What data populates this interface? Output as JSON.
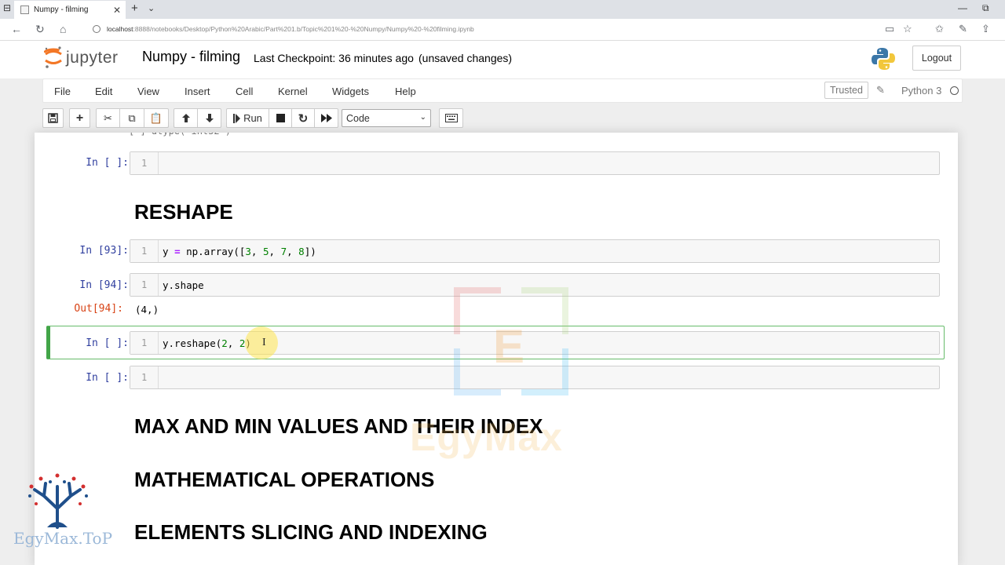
{
  "browser": {
    "tab_title": "Numpy - filming",
    "tab_close": "✕",
    "new_tab": "+",
    "url_host": "localhost",
    "url_rest": ":8888/notebooks/Desktop/Python%20Arabic/Part%201.b/Topic%201%20-%20Numpy/Numpy%20-%20filming.ipynb"
  },
  "header": {
    "logo_text": "jupyter",
    "notebook_title": "Numpy - filming",
    "checkpoint": "Last Checkpoint: 36 minutes ago",
    "unsaved": "(unsaved changes)",
    "logout": "Logout"
  },
  "menu": {
    "items": [
      "File",
      "Edit",
      "View",
      "Insert",
      "Cell",
      "Kernel",
      "Widgets",
      "Help"
    ],
    "trusted": "Trusted",
    "kernel_name": "Python 3"
  },
  "toolbar": {
    "run_label": "Run",
    "cell_type": "Code"
  },
  "cells": {
    "c1": {
      "prompt": "In [ ]:",
      "line": "1"
    },
    "heading_reshape": "RESHAPE",
    "c2": {
      "prompt": "In [93]:",
      "line": "1"
    },
    "c3": {
      "prompt": "In [94]:",
      "line": "1",
      "code": "y.shape",
      "out_prompt": "Out[94]:",
      "output": "(4,)"
    },
    "c4": {
      "prompt": "In [ ]:",
      "line": "1"
    },
    "c5": {
      "prompt": "In [ ]:",
      "line": "1"
    },
    "heading_maxmin": "MAX AND MIN VALUES AND THEIR INDEX",
    "heading_math": "MATHEMATICAL OPERATIONS",
    "heading_slicing": "ELEMENTS SLICING AND INDEXING"
  },
  "watermark": {
    "box_letter": "E",
    "brand": "EgyMax",
    "site": "EgyMax.ToP"
  },
  "colors": {
    "prompt_in": "#303f9f",
    "prompt_out": "#d84315",
    "selected_border": "#42a548"
  }
}
